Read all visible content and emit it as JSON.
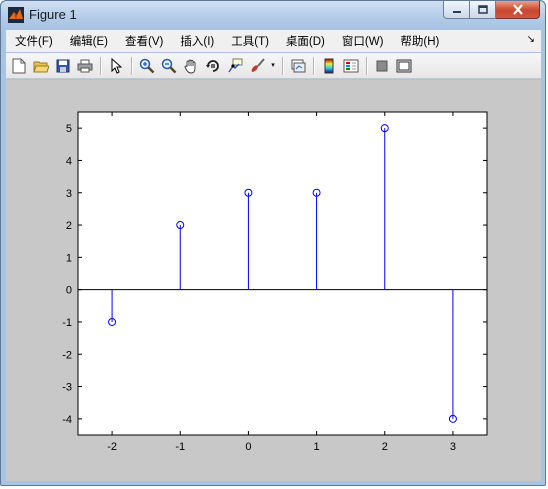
{
  "window": {
    "title": "Figure 1",
    "app_icon": "matlab-icon",
    "buttons": [
      "minimize-icon",
      "maximize-icon",
      "close-icon"
    ]
  },
  "menubar": {
    "items": [
      "文件(F)",
      "编辑(E)",
      "查看(V)",
      "插入(I)",
      "工具(T)",
      "桌面(D)",
      "窗口(W)",
      "帮助(H)"
    ]
  },
  "toolbar": {
    "icons": [
      "new-figure-icon",
      "open-file-icon",
      "save-icon",
      "print-icon",
      "select-arrow-icon",
      "zoom-in-icon",
      "zoom-out-icon",
      "pan-hand-icon",
      "rotate-3d-icon",
      "data-cursor-icon",
      "brush-icon",
      "link-plot-icon",
      "colorbar-icon",
      "legend-icon",
      "hide-plot-tools-icon",
      "show-plot-tools-icon"
    ]
  },
  "colors": {
    "stem": "#0000ff",
    "axes_background": "#ffffff",
    "figure_background": "#c8c8c8"
  },
  "chart_data": {
    "type": "stem",
    "title": "",
    "xlabel": "",
    "ylabel": "",
    "x": [
      -2,
      -1,
      0,
      1,
      2,
      3
    ],
    "y": [
      -1,
      2,
      3,
      3,
      5,
      -4
    ],
    "xlim": [
      -2.5,
      3.5
    ],
    "ylim": [
      -4.5,
      5.5
    ],
    "xticks": [
      -2,
      -1,
      0,
      1,
      2,
      3
    ],
    "yticks": [
      -4,
      -3,
      -2,
      -1,
      0,
      1,
      2,
      3,
      4,
      5
    ],
    "xtick_labels": [
      "-2",
      "-1",
      "0",
      "1",
      "2",
      "3"
    ],
    "ytick_labels": [
      "-4",
      "-3",
      "-2",
      "-1",
      "0",
      "1",
      "2",
      "3",
      "4",
      "5"
    ],
    "marker": "circle",
    "grid": false,
    "baseline": 0
  }
}
